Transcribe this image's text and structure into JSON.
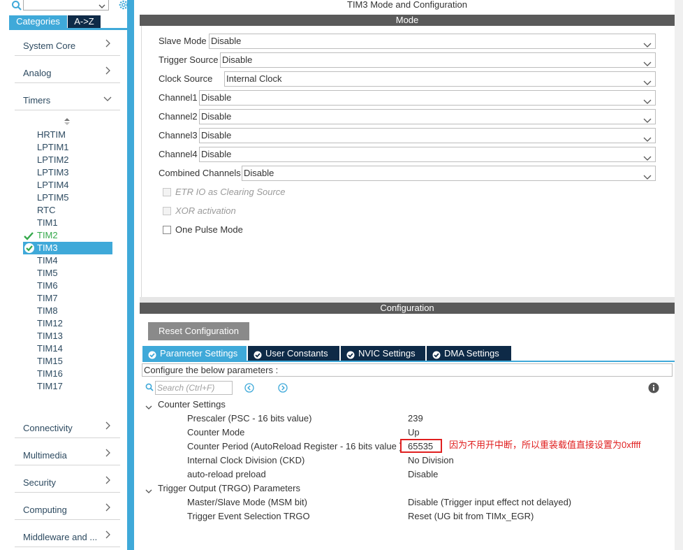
{
  "window": {
    "title": "TIM3 Mode and Configuration"
  },
  "sidebar": {
    "search_value": "",
    "tabs": [
      {
        "label": "Categories"
      },
      {
        "label": "A->Z"
      }
    ],
    "categories": [
      {
        "label": "System Core"
      },
      {
        "label": "Analog"
      },
      {
        "label": "Timers"
      },
      {
        "label": "Connectivity"
      },
      {
        "label": "Multimedia"
      },
      {
        "label": "Security"
      },
      {
        "label": "Computing"
      },
      {
        "label": "Middleware and ..."
      }
    ],
    "timers": [
      "HRTIM",
      "LPTIM1",
      "LPTIM2",
      "LPTIM3",
      "LPTIM4",
      "LPTIM5",
      "RTC",
      "TIM1",
      "TIM2",
      "TIM3",
      "TIM4",
      "TIM5",
      "TIM6",
      "TIM7",
      "TIM8",
      "TIM12",
      "TIM13",
      "TIM14",
      "TIM15",
      "TIM16",
      "TIM17"
    ],
    "enabled_timer": "TIM2",
    "selected_timer": "TIM3"
  },
  "mode": {
    "section_title": "Mode",
    "fields": [
      {
        "label": "Slave Mode",
        "value": "Disable"
      },
      {
        "label": "Trigger Source",
        "value": "Disable"
      },
      {
        "label": "Clock Source",
        "value": "Internal Clock"
      },
      {
        "label": "Channel1",
        "value": "Disable"
      },
      {
        "label": "Channel2",
        "value": "Disable"
      },
      {
        "label": "Channel3",
        "value": "Disable"
      },
      {
        "label": "Channel4",
        "value": "Disable"
      },
      {
        "label": "Combined Channels",
        "value": "Disable"
      }
    ],
    "checkboxes": [
      {
        "label": "ETR IO as Clearing Source",
        "disabled": true,
        "checked": false
      },
      {
        "label": "XOR activation",
        "disabled": true,
        "checked": false
      },
      {
        "label": "One Pulse Mode",
        "disabled": false,
        "checked": false
      }
    ]
  },
  "configuration": {
    "section_title": "Configuration",
    "reset_label": "Reset Configuration",
    "tabs": [
      {
        "label": "Parameter Settings",
        "active": true
      },
      {
        "label": "User Constants",
        "active": false
      },
      {
        "label": "NVIC Settings",
        "active": false
      },
      {
        "label": "DMA Settings",
        "active": false
      }
    ],
    "note": "Configure the below parameters :",
    "search_placeholder": "Search (Ctrl+F)",
    "groups": [
      {
        "label": "Counter Settings",
        "params": [
          {
            "name": "Prescaler (PSC - 16 bits value)",
            "value": "239"
          },
          {
            "name": "Counter Mode",
            "value": "Up"
          },
          {
            "name": "Counter Period (AutoReload Register - 16 bits value )",
            "value": "65535"
          },
          {
            "name": "Internal Clock Division (CKD)",
            "value": "No Division"
          },
          {
            "name": "auto-reload preload",
            "value": "Disable"
          }
        ]
      },
      {
        "label": "Trigger Output (TRGO) Parameters",
        "params": [
          {
            "name": "Master/Slave Mode (MSM bit)",
            "value": "Disable (Trigger input effect not delayed)"
          },
          {
            "name": "Trigger Event Selection TRGO",
            "value": "Reset (UG bit from TIMx_EGR)"
          }
        ]
      }
    ],
    "annotation": "因为不用开中断，所以重装载值直接设置为0xffff"
  },
  "colors": {
    "accent": "#3fa9d9",
    "dark_tab": "#0e2a47",
    "section_bar": "#5a5a5a",
    "green": "#35a94c",
    "annotation_red": "#e02020"
  }
}
